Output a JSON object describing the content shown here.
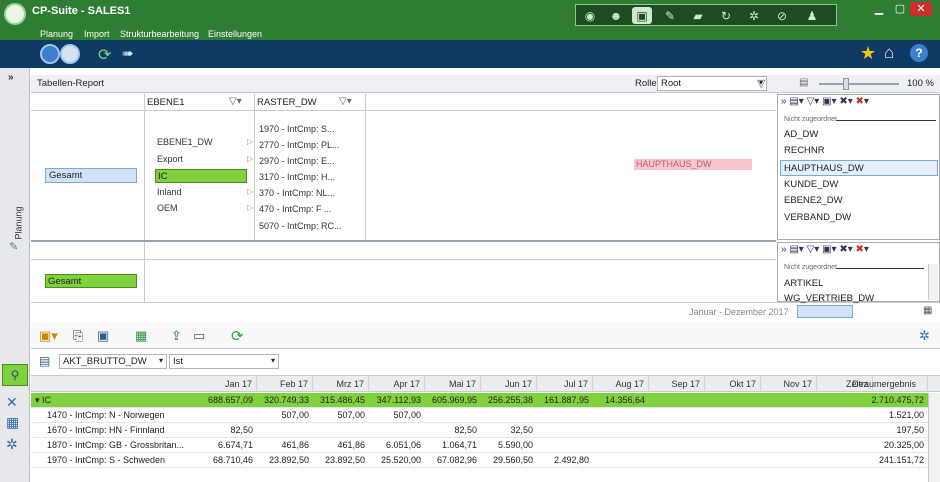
{
  "app": {
    "title": "CP-Suite - SALES1"
  },
  "menu": [
    "Planung",
    "Import",
    "Strukturbearbeitung",
    "Einstellungen"
  ],
  "colors": {
    "brand_green": "#2f7d32",
    "toolbar_blue": "#0f3a63",
    "select_green": "#7fd23d",
    "highlight_pink": "#f7c6cf"
  },
  "report": {
    "title": "Tabellen-Report",
    "rolle_label": "Rolle:",
    "rolle_value": "Root",
    "zoom": "100 %",
    "col1_header": "EBENE1",
    "col2_header": "RASTER_DW",
    "root_node": "Gesamt",
    "ebene_nodes": [
      "EBENE1_DW",
      "Export",
      "IC",
      "Inland",
      "OEM"
    ],
    "raster_nodes": [
      "1970 - IntCmp: S...",
      "2770 - IntCmp: PL...",
      "2970 - IntCmp: E...",
      "3170 - IntCmp: H...",
      "370 - IntCmp: NL...",
      "470 - IntCmp: F ...",
      "5070 - IntCmp: RC..."
    ],
    "hauptaus_label": "HAUPTHAUS_DW",
    "lower_root_node": "Gesamt",
    "timeline_label": "Januar - Dezember 2017"
  },
  "right_panel_top": {
    "header": "Nicht zugeordnet",
    "items": [
      "AD_DW",
      "RECHNR",
      "HAUPTHAUS_DW",
      "KUNDE_DW",
      "EBENE2_DW",
      "VERBAND_DW"
    ]
  },
  "right_panel_bottom": {
    "header": "Nicht zugeordnet",
    "items": [
      "ARTIKEL",
      "WG_VERTRIEB_DW"
    ]
  },
  "leftnav": {
    "label": "Planung"
  },
  "bottom": {
    "measure": "AKT_BRUTTO_DW",
    "version": "Ist",
    "months": [
      "Jan 17",
      "Feb 17",
      "Mrz 17",
      "Apr 17",
      "Mai 17",
      "Jun 17",
      "Jul 17",
      "Aug 17",
      "Sep 17",
      "Okt 17",
      "Nov 17",
      "Dez"
    ],
    "total_header": "Zeitraumergebnis",
    "rows": [
      {
        "label": "IC",
        "values": [
          "688.657,09",
          "320.749,33",
          "315.486,45",
          "347.112,93",
          "605.969,95",
          "256.255,38",
          "161.887,95",
          "14.356,64",
          "",
          "",
          "",
          ""
        ],
        "total": "2.710.475,72",
        "highlight": true
      },
      {
        "label": "1470 - IntCmp: N - Norwegen",
        "values": [
          "",
          "507,00",
          "507,00",
          "507,00",
          "",
          "",
          "",
          "",
          "",
          "",
          "",
          ""
        ],
        "total": "1.521,00",
        "highlight": false
      },
      {
        "label": "1670 - IntCmp: HN - Finnland",
        "values": [
          "82,50",
          "",
          "",
          "",
          "82,50",
          "32,50",
          "",
          "",
          "",
          "",
          "",
          ""
        ],
        "total": "197,50",
        "highlight": false
      },
      {
        "label": "1870 - IntCmp: GB - Grossbritan...",
        "values": [
          "6.674,71",
          "461,86",
          "461,86",
          "6.051,06",
          "1.064,71",
          "5.590,00",
          "",
          "",
          "",
          "",
          "",
          ""
        ],
        "total": "20.325,00",
        "highlight": false
      },
      {
        "label": "1970 - IntCmp: S - Schweden",
        "values": [
          "68.710,46",
          "23.892,50",
          "23.892,50",
          "25.520,00",
          "67.082,96",
          "29.560,50",
          "2.492,80",
          "",
          "",
          "",
          "",
          ""
        ],
        "total": "241.151,72",
        "highlight": false
      }
    ]
  }
}
